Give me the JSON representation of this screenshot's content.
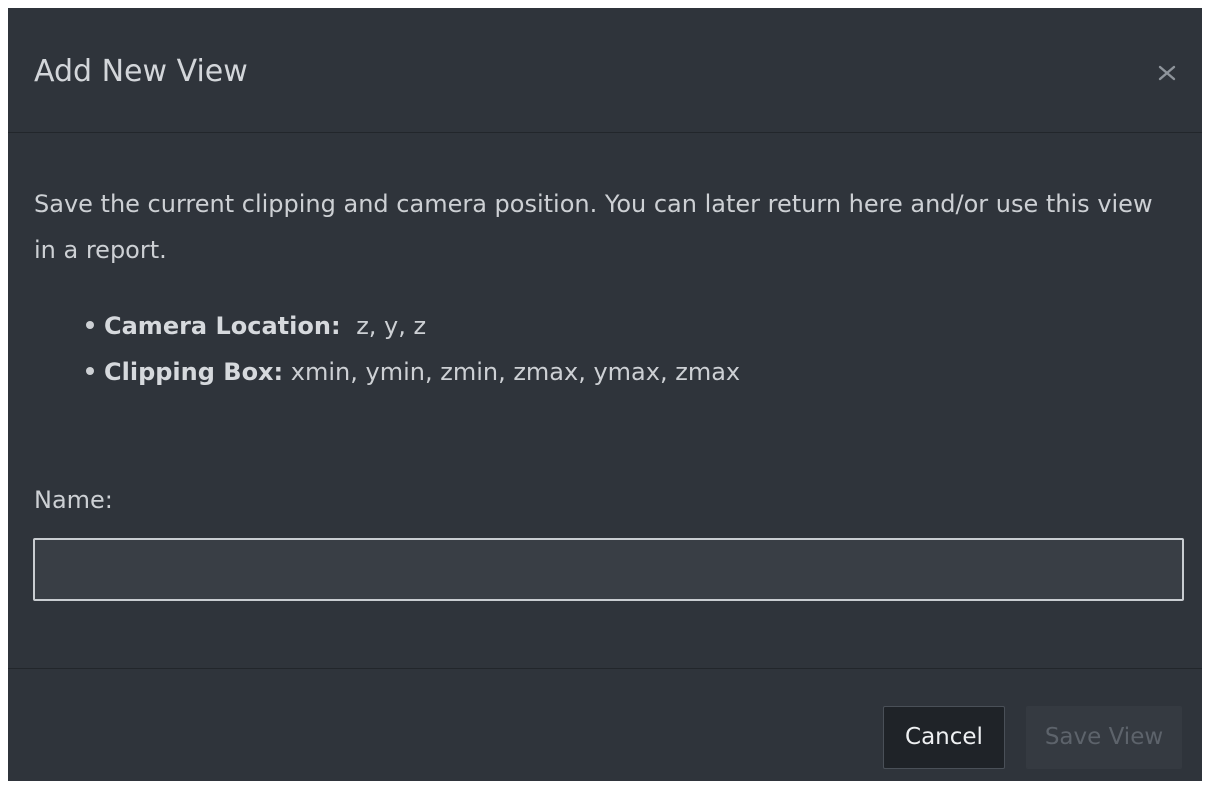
{
  "dialog": {
    "title": "Add New View",
    "close_icon": "close-icon",
    "description": "Save the current clipping and camera position. You can later return here and/or use this view in a report.",
    "details": [
      {
        "label": "Camera Location:",
        "value": "z, y, z"
      },
      {
        "label": "Clipping Box:",
        "value": "xmin, ymin, zmin, zmax, ymax, zmax"
      }
    ],
    "name_label": "Name:",
    "name_value": "",
    "name_placeholder": "",
    "cancel_label": "Cancel",
    "save_label": "Save View",
    "save_enabled": false
  },
  "colors": {
    "background": "#2f343b",
    "text": "#cdd0d4",
    "input_border": "#c9cdd1",
    "cancel_bg": "#1f2328",
    "save_disabled_text": "#5d636b"
  }
}
